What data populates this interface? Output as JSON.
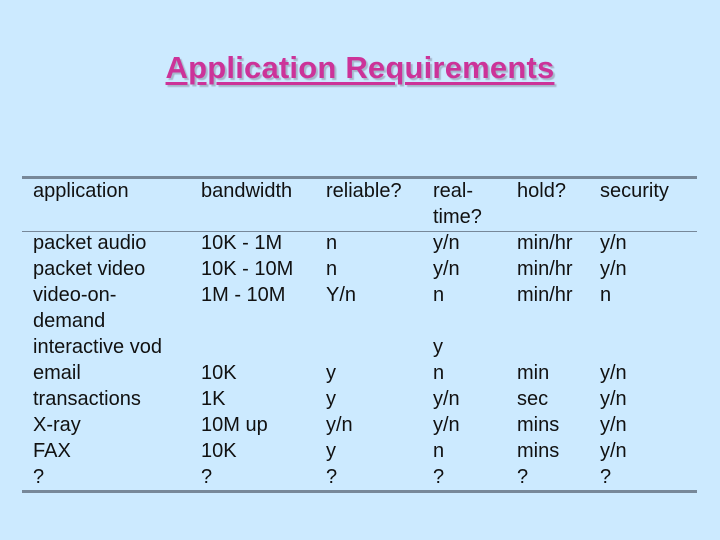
{
  "slide": {
    "title": "Application Requirements",
    "accent_color": "#cc3399",
    "background_color": "#cceaff"
  },
  "table": {
    "headers": [
      [
        "application"
      ],
      [
        "bandwidth"
      ],
      [
        "reliable?"
      ],
      [
        "real-",
        "time?"
      ],
      [
        "hold?"
      ],
      [
        "security"
      ]
    ],
    "rows": [
      [
        "packet audio",
        "10K - 1M",
        "n",
        "y/n",
        "min/hr",
        "y/n"
      ],
      [
        "packet video",
        "10K - 10M",
        "n",
        "y/n",
        "min/hr",
        "y/n"
      ],
      [
        "video-on-",
        "1M - 10M",
        "Y/n",
        "n",
        "min/hr",
        "n"
      ],
      [
        "demand",
        "",
        "",
        "",
        "",
        ""
      ],
      [
        "interactive vod",
        "",
        "",
        "y",
        "",
        ""
      ],
      [
        "email",
        "10K",
        "y",
        "n",
        "min",
        "y/n"
      ],
      [
        "transactions",
        "1K",
        "y",
        "y/n",
        "sec",
        "y/n"
      ],
      [
        "X-ray",
        "10M up",
        "y/n",
        "y/n",
        "mins",
        "y/n"
      ],
      [
        "FAX",
        "10K",
        "y",
        "n",
        "mins",
        "y/n"
      ],
      [
        "?",
        "?",
        "?",
        "?",
        "?",
        "?"
      ]
    ]
  }
}
